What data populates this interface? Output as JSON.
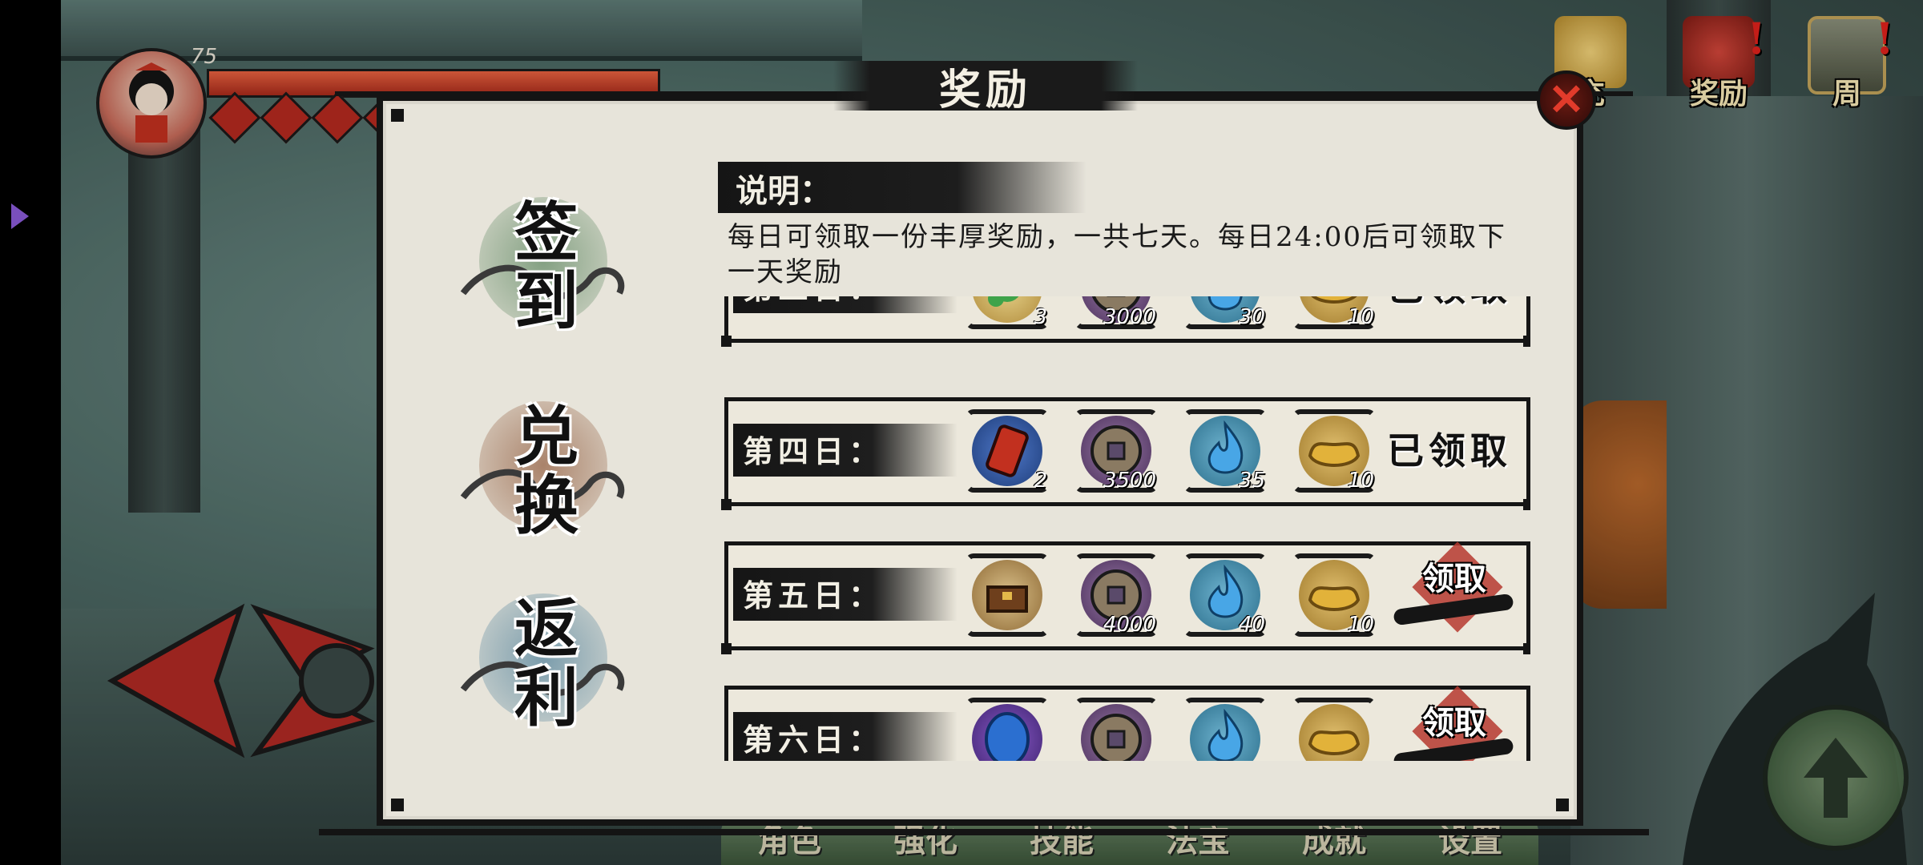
{
  "hud": {
    "level": "75"
  },
  "top_right": [
    {
      "label": "充",
      "icon": "gift-bow-icon",
      "alert": ""
    },
    {
      "label": "奖励",
      "icon": "reward-pouch-icon",
      "alert": "!"
    },
    {
      "label": "周",
      "icon": "weekly-book-icon",
      "alert": "!"
    }
  ],
  "bottom_tabs": [
    "角色",
    "强化",
    "技能",
    "法宝",
    "成就",
    "设置"
  ],
  "dialog": {
    "title": "奖励",
    "close_icon": "close-x-icon",
    "menu": [
      {
        "label_top": "签",
        "label_bottom": "到",
        "accent": "#6a8f6c"
      },
      {
        "label_top": "兑",
        "label_bottom": "换",
        "accent": "#9a6a4e"
      },
      {
        "label_top": "返",
        "label_bottom": "利",
        "accent": "#5f8aa0"
      }
    ],
    "info": {
      "heading": "说明：",
      "text": "每日可领取一份丰厚奖励，一共七天。每日24:00后可领取下一天奖励"
    },
    "rows": [
      {
        "day": "第三日：",
        "status": "已领取",
        "items": [
          {
            "icon": "green-pill-icon",
            "count": "3"
          },
          {
            "icon": "copper-coin-icon",
            "count": "3000"
          },
          {
            "icon": "blue-flame-icon",
            "count": "30"
          },
          {
            "icon": "gold-ingot-icon",
            "count": "10"
          }
        ]
      },
      {
        "day": "第四日：",
        "status": "已领取",
        "items": [
          {
            "icon": "red-talisman-icon",
            "count": "2"
          },
          {
            "icon": "copper-coin-icon",
            "count": "3500"
          },
          {
            "icon": "blue-flame-icon",
            "count": "35"
          },
          {
            "icon": "gold-ingot-icon",
            "count": "10"
          }
        ]
      },
      {
        "day": "第五日：",
        "status": "领取",
        "items": [
          {
            "icon": "treasure-chest-icon",
            "count": ""
          },
          {
            "icon": "copper-coin-icon",
            "count": "4000"
          },
          {
            "icon": "blue-flame-icon",
            "count": "40"
          },
          {
            "icon": "gold-ingot-icon",
            "count": "10"
          }
        ]
      },
      {
        "day": "第六日：",
        "status": "领取",
        "items": [
          {
            "icon": "blue-orb-icon",
            "count": ""
          },
          {
            "icon": "copper-coin-icon",
            "count": ""
          },
          {
            "icon": "blue-flame-icon",
            "count": ""
          },
          {
            "icon": "gold-ingot-icon",
            "count": ""
          }
        ]
      }
    ]
  },
  "colors": {
    "hp": "#c23a25",
    "panel": "#e7e4da",
    "ink": "#151515",
    "claim": "#b6382f"
  }
}
